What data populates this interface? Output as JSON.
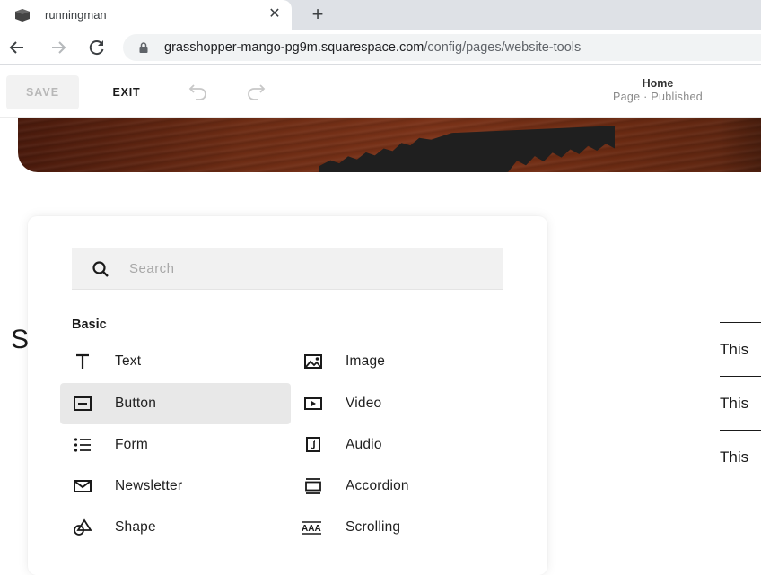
{
  "browser": {
    "tab": {
      "title": "runningman",
      "favicon": "cube-icon",
      "close_glyph": "✕"
    },
    "new_tab_glyph": "+",
    "url": {
      "host": "grasshopper-mango-pg9m.squarespace.com",
      "path": "/config/pages/website-tools"
    }
  },
  "editor": {
    "save_label": "SAVE",
    "exit_label": "EXIT",
    "undo_icon": "undo-icon",
    "redo_icon": "redo-icon",
    "page_name": "Home",
    "page_status": "Page · Published"
  },
  "canvas": {
    "heading_fragment": "S",
    "accordion_items": [
      "This",
      "This",
      "This"
    ]
  },
  "add_block_panel": {
    "search": {
      "placeholder": "Search",
      "value": ""
    },
    "section_title": "Basic",
    "items": [
      {
        "label": "Text",
        "icon": "text-icon",
        "selected": false
      },
      {
        "label": "Image",
        "icon": "image-icon",
        "selected": false
      },
      {
        "label": "Button",
        "icon": "button-icon",
        "selected": true
      },
      {
        "label": "Video",
        "icon": "video-icon",
        "selected": false
      },
      {
        "label": "Form",
        "icon": "form-list-icon",
        "selected": false
      },
      {
        "label": "Audio",
        "icon": "audio-icon",
        "selected": false
      },
      {
        "label": "Newsletter",
        "icon": "envelope-icon",
        "selected": false
      },
      {
        "label": "Accordion",
        "icon": "accordion-icon",
        "selected": false
      },
      {
        "label": "Shape",
        "icon": "shape-icon",
        "selected": false
      },
      {
        "label": "Scrolling",
        "icon": "scrolling-text-icon",
        "selected": false
      }
    ]
  }
}
